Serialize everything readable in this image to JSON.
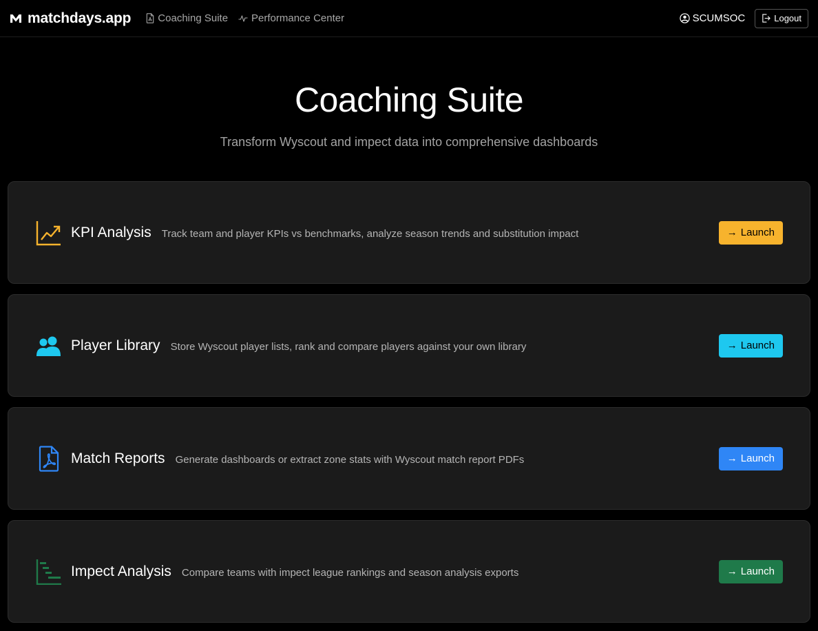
{
  "navbar": {
    "brand": "matchdays.app",
    "links": [
      {
        "label": "Coaching Suite",
        "icon": "pdf-file-icon"
      },
      {
        "label": "Performance Center",
        "icon": "pulse-icon"
      }
    ],
    "user": "SCUMSOC",
    "logout_label": "Logout"
  },
  "hero": {
    "title": "Coaching Suite",
    "subtitle": "Transform Wyscout and impect data into comprehensive dashboards"
  },
  "cards": [
    {
      "title": "KPI Analysis",
      "description": "Track team and player KPIs vs benchmarks, analyze season trends and substitution impact",
      "button": "Launch",
      "icon": "trend-chart-icon",
      "accent": "#f7b32d",
      "button_text_color": "#000000"
    },
    {
      "title": "Player Library",
      "description": "Store Wyscout player lists, rank and compare players against your own library",
      "button": "Launch",
      "icon": "people-icon",
      "accent": "#1ec8ef",
      "button_text_color": "#000000"
    },
    {
      "title": "Match Reports",
      "description": "Generate dashboards or extract zone stats with Wyscout match report PDFs",
      "button": "Launch",
      "icon": "pdf-document-icon",
      "accent": "#2f86f6",
      "button_text_color": "#ffffff"
    },
    {
      "title": "Impect Analysis",
      "description": "Compare teams with impect league rankings and season analysis exports",
      "button": "Launch",
      "icon": "gantt-chart-icon",
      "accent": "#1f7a4a",
      "button_text_color": "#ffffff"
    }
  ]
}
